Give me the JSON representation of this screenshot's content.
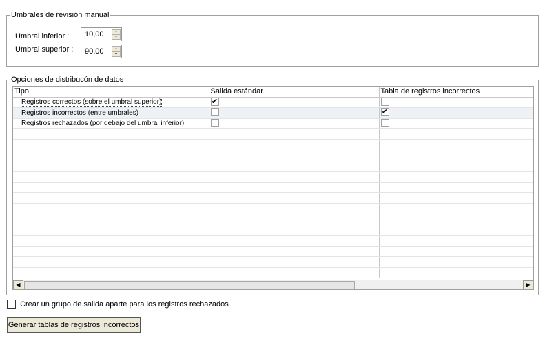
{
  "thresholds": {
    "legend": "Umbrales de revisión manual",
    "lower_label": "Umbral inferior :",
    "lower_value": "10,00",
    "upper_label": "Umbral superior :",
    "upper_value": "90,00"
  },
  "distribution": {
    "legend": "Opciones de distribucón de datos",
    "columns": [
      "Tipo",
      "Salida estándar",
      "Tabla de registros incorrectos"
    ],
    "rows": [
      {
        "type": "Registros correctos (sobre el umbral superior)",
        "standard_output": true,
        "bad_records_table": false
      },
      {
        "type": "Registros incorrectos (entre umbrales)",
        "standard_output": false,
        "bad_records_table": true
      },
      {
        "type": "Registros rechazados (por debajo del umbral inferior)",
        "standard_output": false,
        "bad_records_table": false
      }
    ],
    "empty_rows": 14
  },
  "separate_group_checkbox": {
    "label": "Crear un grupo de salida aparte para los registros rechazados",
    "checked": false
  },
  "generate_button_label": "Generar tablas de registros incorrectos",
  "icons": {
    "check": "checkmark-icon",
    "spin_up": "spin-up-icon",
    "spin_down": "spin-down-icon",
    "scroll_left": "scroll-left-icon",
    "scroll_right": "scroll-right-icon"
  }
}
